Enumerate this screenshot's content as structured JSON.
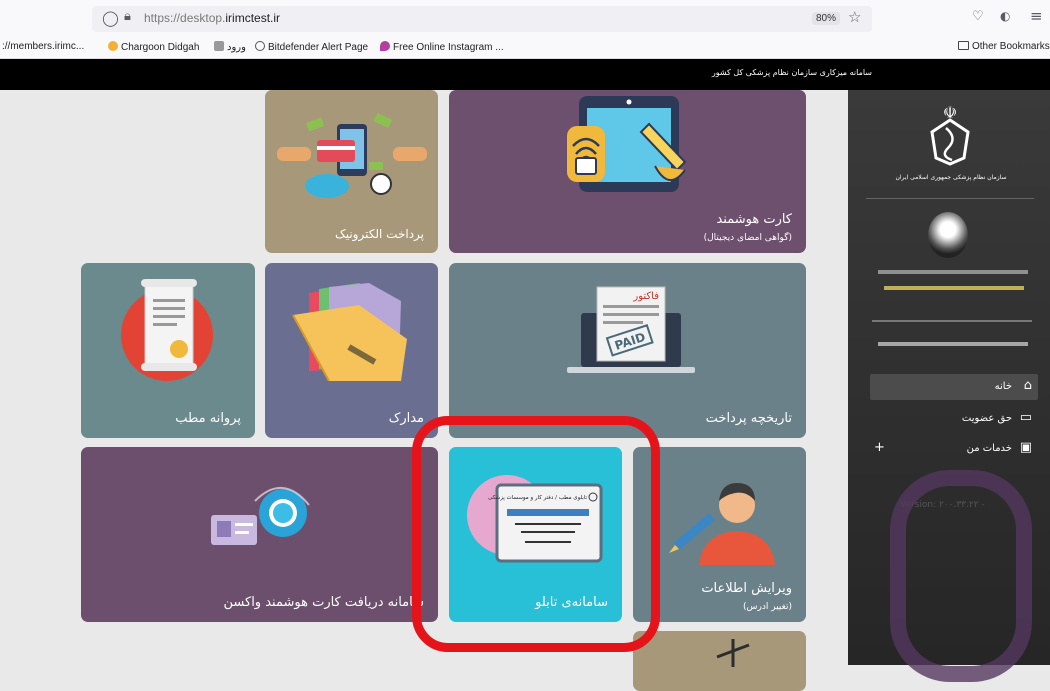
{
  "browser": {
    "url_prefix": "https://desktop.",
    "url_domain": "irimctest.ir",
    "zoom": "80%",
    "bookmarks": [
      {
        "label": "://members.irimc...",
        "color": "#ffffff"
      },
      {
        "label": "Chargoon Didgah",
        "color": "#f2b134"
      },
      {
        "label": "ورود",
        "color": "#777777"
      },
      {
        "label": "Bitdefender Alert Page",
        "color": "#555555"
      },
      {
        "label": "Free Online Instagram ...",
        "color": "#b33fa0"
      }
    ],
    "other_bookmarks": "Other Bookmarks"
  },
  "site": {
    "title": "سامانه میزکاری سازمان نظام پزشکی کل کشور"
  },
  "sidebar": {
    "org_name": "سازمان نظام پزشکی جمهوری اسلامی ایران",
    "nav": [
      {
        "label": "خانه",
        "icon": "home-icon"
      },
      {
        "label": "حق عضویت",
        "icon": "monitor-icon"
      },
      {
        "label": "خدمات من",
        "icon": "laptop-icon"
      }
    ],
    "plus": "+",
    "version": "Version: ۲۰۰.۳۳.۲۲ -"
  },
  "tiles": {
    "electronic_payment": {
      "label": "پرداخت الکترونیک",
      "color": "#a8987a"
    },
    "smart_card": {
      "label": "کارت هوشمند",
      "sub": "(گواهی امضای دیجیتال)",
      "color": "#6d4f6e"
    },
    "practice_license": {
      "label": "پروانه مطب",
      "color": "#6a8a8d"
    },
    "documents": {
      "label": "مدارک",
      "color": "#6a6f92"
    },
    "payment_history": {
      "label": "تاریخچه پرداخت",
      "color": "#6b8189"
    },
    "vaccine_card": {
      "label": "سامانه دریافت کارت هوشمند واکسن",
      "color": "#6c4f6d"
    },
    "signboard": {
      "label": "سامانه‌ی تابلو",
      "color": "#27c0d6",
      "card_title": "تابلوی مطب / دفتر کار و موسسات پزشکی"
    },
    "edit_info": {
      "label": "ویرایش اطلاعات",
      "sub": "(تغییر ادرس)",
      "color": "#6b8189"
    },
    "bottom": {
      "color": "#a8987a"
    }
  },
  "payment_history_paper": {
    "header": "فاکتور",
    "stamp": "PAID"
  }
}
